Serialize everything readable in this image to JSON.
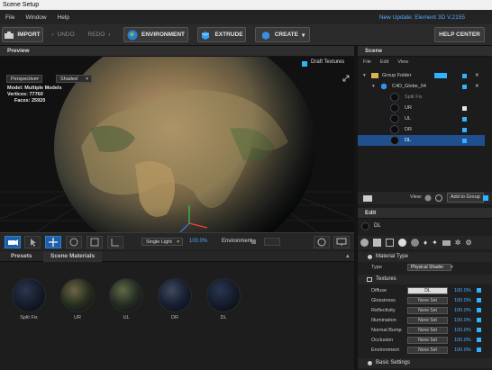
{
  "window": {
    "title": "Scene Setup"
  },
  "menu": [
    "File",
    "Window",
    "Help"
  ],
  "update_notice": "New Update: Element 3D V.2155",
  "toolbar": {
    "import": "IMPORT",
    "undo": "UNDO",
    "redo": "REDO",
    "environment": "ENVIRONMENT",
    "extrude": "EXTRUDE",
    "create": "CREATE",
    "help": "HELP CENTER"
  },
  "preview": {
    "title": "Preview",
    "draft_textures": "Draft Textures",
    "camera": "Perspective",
    "shading": "Shaded",
    "model_label": "Model:",
    "model_value": "Multiple Models",
    "vertices_label": "Vertices:",
    "vertices_value": "77760",
    "faces_label": "Faces:",
    "faces_value": "25920"
  },
  "viewport_toolbar": {
    "light_mode": "Single Light",
    "light_pct": "100.0%",
    "environment": "Environment"
  },
  "presets": {
    "tabs": [
      "Presets",
      "Scene Materials"
    ],
    "materials": [
      "Split Fix",
      "UR",
      "UL",
      "DR",
      "DL"
    ]
  },
  "scene": {
    "title": "Scene",
    "menu": [
      "File",
      "Edit",
      "View"
    ],
    "items": [
      {
        "label": "Group Folder",
        "kind": "folder"
      },
      {
        "label": "C4D_Globe_04",
        "kind": "model"
      },
      {
        "label": "Split Fix",
        "kind": "material"
      },
      {
        "label": "UR",
        "kind": "material"
      },
      {
        "label": "UL",
        "kind": "material"
      },
      {
        "label": "DR",
        "kind": "material"
      },
      {
        "label": "DL",
        "kind": "material",
        "selected": true
      }
    ],
    "view_label": "View:",
    "add_to_group": "Add to Group"
  },
  "edit": {
    "title": "Edit",
    "selected_name": "DL",
    "material_type_section": "Material Type",
    "type_label": "Type",
    "type_value": "Physical Shader",
    "textures_section": "Textures",
    "textures": [
      {
        "name": "Diffuse",
        "value": "DL",
        "pct": "100.0%"
      },
      {
        "name": "Glossiness",
        "value": "None Set",
        "pct": "100.0%"
      },
      {
        "name": "Reflectivity",
        "value": "None Set",
        "pct": "100.0%"
      },
      {
        "name": "Illumination",
        "value": "None Set",
        "pct": "100.0%"
      },
      {
        "name": "Normal Bump",
        "value": "None Set",
        "pct": "100.0%"
      },
      {
        "name": "Occlusion",
        "value": "None Set",
        "pct": "100.0%"
      },
      {
        "name": "Environment",
        "value": "None Set",
        "pct": "100.0%"
      }
    ],
    "basic_settings": "Basic Settings"
  },
  "colors": {
    "accent": "#2fb2ff",
    "update": "#56a9ff",
    "selection": "#1f4f8c"
  }
}
